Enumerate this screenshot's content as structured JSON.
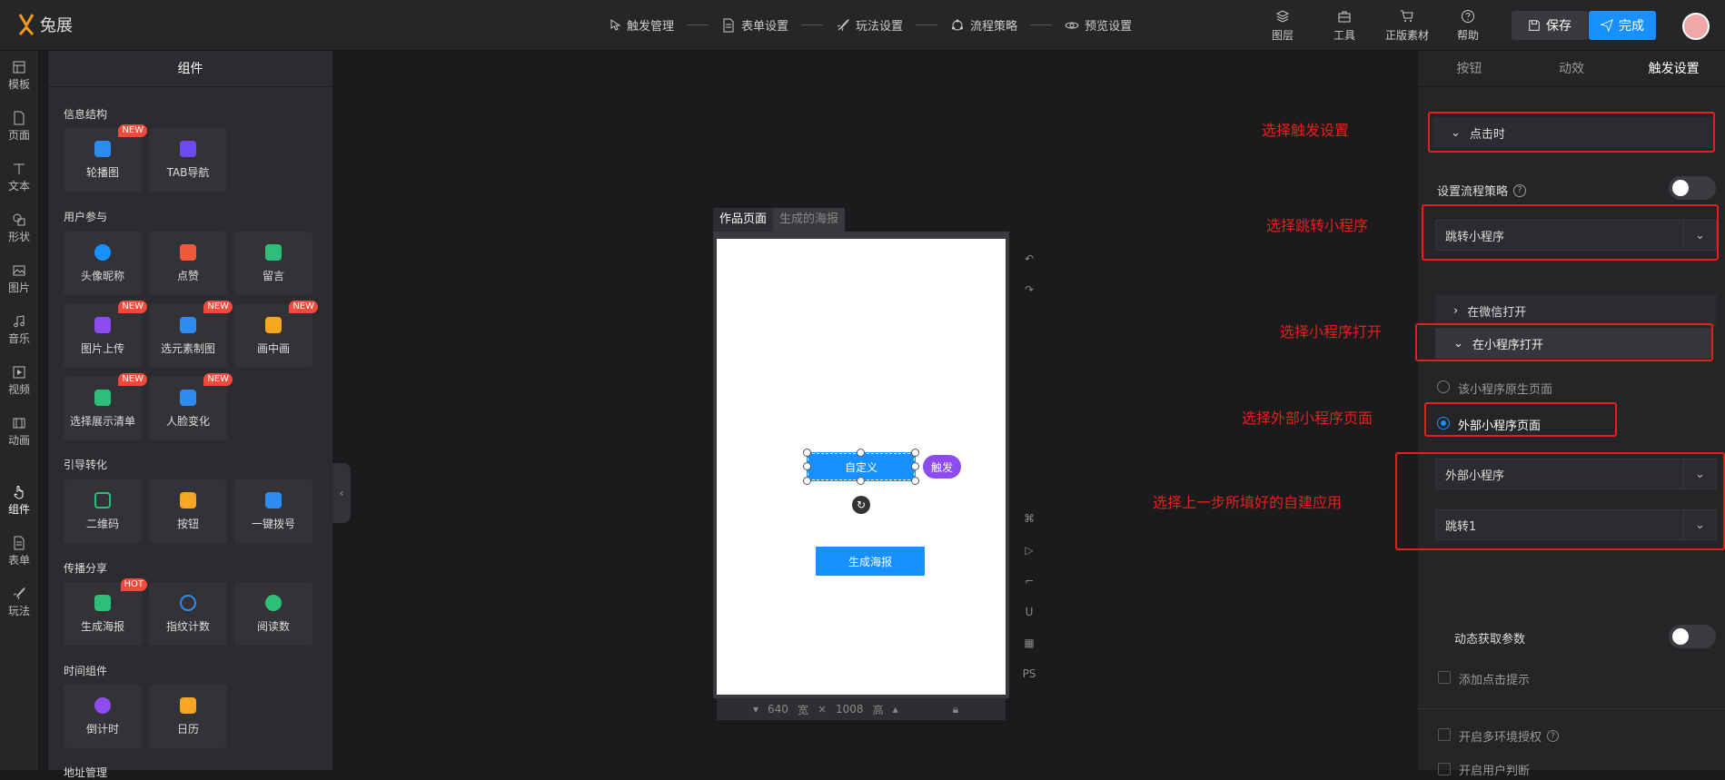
{
  "logo": {
    "text": "兔展"
  },
  "steps": [
    "触发管理",
    "表单设置",
    "玩法设置",
    "流程策略",
    "预览设置"
  ],
  "tools": [
    "图层",
    "工具",
    "正版素材",
    "帮助"
  ],
  "save_label": "保存",
  "done_label": "完成",
  "rail": [
    "模板",
    "页面",
    "文本",
    "形状",
    "图片",
    "音乐",
    "视频",
    "动画",
    "组件",
    "表单",
    "玩法"
  ],
  "panel": {
    "title": "组件",
    "groups": [
      "信息结构",
      "用户参与",
      "引导转化",
      "传播分享",
      "时间组件",
      "地址管理"
    ],
    "items": {
      "carousel": "轮播图",
      "tabnav": "TAB导航",
      "avatar": "头像昵称",
      "like": "点赞",
      "comment": "留言",
      "upload": "图片上传",
      "material": "选元素制图",
      "pip": "画中画",
      "showlist": "选择展示清单",
      "face": "人脸变化",
      "qrcode": "二维码",
      "button": "按钮",
      "call": "一键拨号",
      "poster": "生成海报",
      "fingerprint": "指纹计数",
      "views": "阅读数",
      "countdown": "倒计时",
      "calendar": "日历"
    },
    "badges": {
      "new": "NEW",
      "hot": "HOT"
    }
  },
  "canvas": {
    "tabs": [
      "作品页面",
      "生成的海报"
    ],
    "custom_button": "自定义",
    "trigger_tag": "触发",
    "poster_button": "生成海报",
    "width": "640",
    "width_label": "宽",
    "height": "1008",
    "height_label": "高",
    "ps": "PS"
  },
  "right": {
    "tabs": [
      "按钮",
      "动效",
      "触发设置"
    ],
    "trigger_event": "点击时",
    "flow_label": "设置流程策略",
    "action": "跳转小程序",
    "open_wechat": "在微信打开",
    "open_mini": "在小程序打开",
    "radio_native": "该小程序原生页面",
    "radio_external": "外部小程序页面",
    "mini_select": "外部小程序",
    "jump_select": "跳转1",
    "dynamic_params": "动态获取参数",
    "add_tip": "添加点击提示",
    "multi_env": "开启多环境授权",
    "last_item": "开启用户判断"
  },
  "notes": [
    "选择触发设置",
    "选择跳转小程序",
    "选择小程序打开",
    "选择外部小程序页面",
    "选择上一步所填好的自建应用"
  ]
}
